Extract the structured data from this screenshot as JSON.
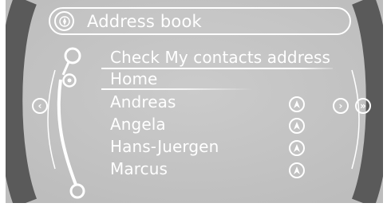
{
  "header": {
    "title": "Address book",
    "icon": "compass-icon"
  },
  "menu": {
    "items": [
      {
        "label": "Check My contacts address",
        "icon": ""
      },
      {
        "label": "Home",
        "icon": ""
      },
      {
        "label": "Andreas",
        "icon": "navigation-icon"
      },
      {
        "label": "Angela",
        "icon": "navigation-icon"
      },
      {
        "label": "Hans-Juergen",
        "icon": "navigation-icon"
      },
      {
        "label": "Marcus",
        "icon": "navigation-icon"
      }
    ],
    "selected_index": 1
  },
  "controls": {
    "left_arrow": "‹",
    "right_arrow": "›",
    "right_double_arrow": "»"
  },
  "colors": {
    "background": "#c7c7c7",
    "foreground": "#ffffff"
  }
}
